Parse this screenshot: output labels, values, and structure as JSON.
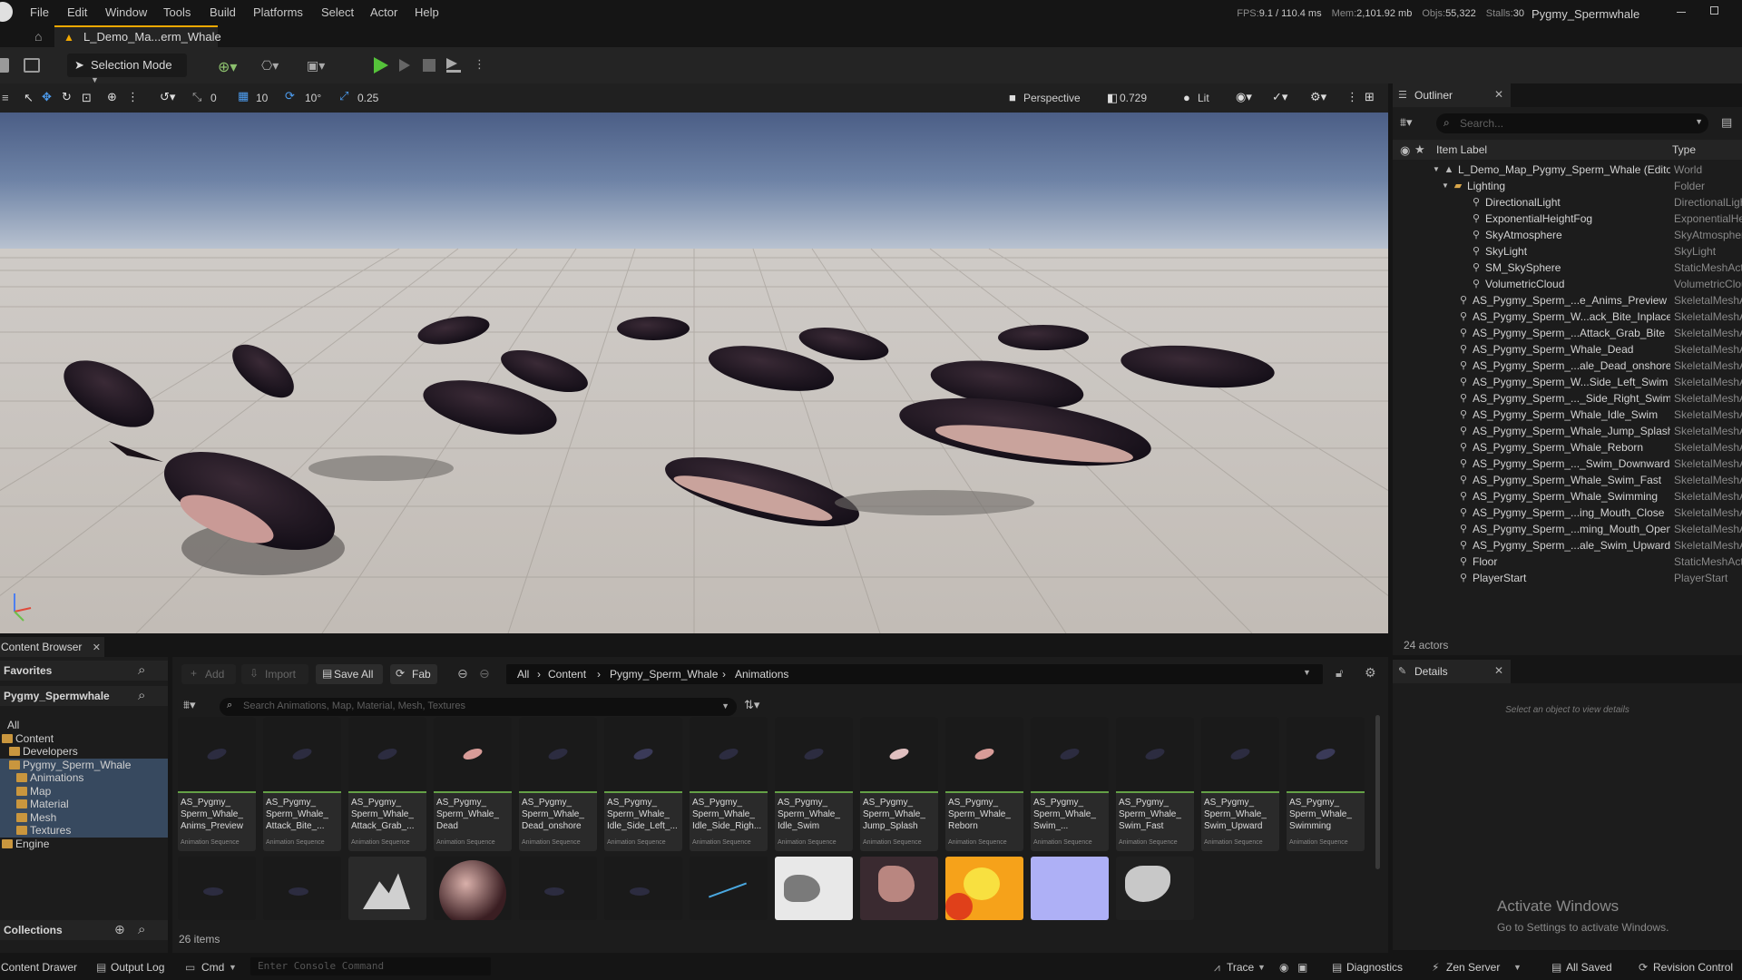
{
  "menu": [
    "File",
    "Edit",
    "Window",
    "Tools",
    "Build",
    "Platforms",
    "Select",
    "Actor",
    "Help"
  ],
  "stats": {
    "fps_label": "FPS:",
    "fps": "9.1",
    "ms": "/ 110.4 ms",
    "mem_label": "Mem:",
    "mem": "2,101.92 mb",
    "objs_label": "Objs:",
    "objs": "55,322",
    "stalls_label": "Stalls:",
    "stalls": "30"
  },
  "project_name": "Pygmy_Spermwhale",
  "level_tab": "L_Demo_Ma...erm_Whale",
  "toolbar": {
    "selection_mode": "Selection Mode"
  },
  "viewport": {
    "snap_rotate": "0",
    "grid_snap": "10",
    "rotation_snap": "10°",
    "scale_snap": "0.25",
    "perspective": "Perspective",
    "fov": "0.729",
    "view_mode": "Lit"
  },
  "outliner": {
    "tab": "Outliner",
    "search_placeholder": "Search...",
    "col_label": "Item Label",
    "col_type": "Type",
    "items": [
      {
        "label": "L_Demo_Map_Pygmy_Sperm_Whale (Editor)",
        "type": "World",
        "indent": 0
      },
      {
        "label": "Lighting",
        "type": "Folder",
        "indent": 1
      },
      {
        "label": "DirectionalLight",
        "type": "DirectionalLight",
        "indent": 2
      },
      {
        "label": "ExponentialHeightFog",
        "type": "ExponentialHeightFog",
        "indent": 2
      },
      {
        "label": "SkyAtmosphere",
        "type": "SkyAtmosphere",
        "indent": 2
      },
      {
        "label": "SkyLight",
        "type": "SkyLight",
        "indent": 2
      },
      {
        "label": "SM_SkySphere",
        "type": "StaticMeshActor",
        "indent": 2
      },
      {
        "label": "VolumetricCloud",
        "type": "VolumetricCloud",
        "indent": 2
      },
      {
        "label": "AS_Pygmy_Sperm_...e_Anims_Preview",
        "type": "SkeletalMeshActor",
        "indent": 1
      },
      {
        "label": "AS_Pygmy_Sperm_W...ack_Bite_Inplace",
        "type": "SkeletalMeshActor",
        "indent": 1
      },
      {
        "label": "AS_Pygmy_Sperm_...Attack_Grab_Bite",
        "type": "SkeletalMeshActor",
        "indent": 1
      },
      {
        "label": "AS_Pygmy_Sperm_Whale_Dead",
        "type": "SkeletalMeshActor",
        "indent": 1
      },
      {
        "label": "AS_Pygmy_Sperm_...ale_Dead_onshore",
        "type": "SkeletalMeshActor",
        "indent": 1
      },
      {
        "label": "AS_Pygmy_Sperm_W...Side_Left_Swim",
        "type": "SkeletalMeshActor",
        "indent": 1
      },
      {
        "label": "AS_Pygmy_Sperm_..._Side_Right_Swim",
        "type": "SkeletalMeshActor",
        "indent": 1
      },
      {
        "label": "AS_Pygmy_Sperm_Whale_Idle_Swim",
        "type": "SkeletalMeshActor",
        "indent": 1
      },
      {
        "label": "AS_Pygmy_Sperm_Whale_Jump_Splash",
        "type": "SkeletalMeshActor",
        "indent": 1
      },
      {
        "label": "AS_Pygmy_Sperm_Whale_Reborn",
        "type": "SkeletalMeshActor",
        "indent": 1
      },
      {
        "label": "AS_Pygmy_Sperm_..._Swim_Downward",
        "type": "SkeletalMeshActor",
        "indent": 1
      },
      {
        "label": "AS_Pygmy_Sperm_Whale_Swim_Fast",
        "type": "SkeletalMeshActor",
        "indent": 1
      },
      {
        "label": "AS_Pygmy_Sperm_Whale_Swimming",
        "type": "SkeletalMeshActor",
        "indent": 1
      },
      {
        "label": "AS_Pygmy_Sperm_...ing_Mouth_Close",
        "type": "SkeletalMeshActor",
        "indent": 1
      },
      {
        "label": "AS_Pygmy_Sperm_...ming_Mouth_Open",
        "type": "SkeletalMeshActor",
        "indent": 1
      },
      {
        "label": "AS_Pygmy_Sperm_...ale_Swim_Upward",
        "type": "SkeletalMeshActor",
        "indent": 1
      },
      {
        "label": "Floor",
        "type": "StaticMeshActor",
        "indent": 1
      },
      {
        "label": "PlayerStart",
        "type": "PlayerStart",
        "indent": 1
      }
    ],
    "actor_count": "24 actors"
  },
  "details": {
    "tab": "Details",
    "empty_message": "Select an object to view details"
  },
  "activate_windows": {
    "title": "Activate Windows",
    "subtitle": "Go to Settings to activate Windows."
  },
  "content_browser": {
    "tab": "Content Browser",
    "favorites": "Favorites",
    "project": "Pygmy_Spermwhale",
    "tree": [
      {
        "label": "All",
        "indent": 0,
        "selected": false
      },
      {
        "label": "Content",
        "indent": 1,
        "selected": false
      },
      {
        "label": "Developers",
        "indent": 2,
        "selected": false
      },
      {
        "label": "Pygmy_Sperm_Whale",
        "indent": 2,
        "selected": true
      },
      {
        "label": "Animations",
        "indent": 3,
        "selected": true
      },
      {
        "label": "Map",
        "indent": 3,
        "selected": true
      },
      {
        "label": "Material",
        "indent": 3,
        "selected": true
      },
      {
        "label": "Mesh",
        "indent": 3,
        "selected": true
      },
      {
        "label": "Textures",
        "indent": 3,
        "selected": true
      },
      {
        "label": "Engine",
        "indent": 1,
        "selected": false
      }
    ],
    "collections": "Collections",
    "add": "Add",
    "import": "Import",
    "save_all": "Save All",
    "fab": "Fab",
    "breadcrumb": [
      "All",
      "Content",
      "Pygmy_Sperm_Whale",
      "Animations"
    ],
    "search_placeholder": "Search Animations, Map, Material, Mesh, Textures",
    "assets": [
      {
        "name": "AS_Pygmy_ Sperm_Whale_ Anims_Preview",
        "type": "Animation Sequence"
      },
      {
        "name": "AS_Pygmy_ Sperm_Whale_ Attack_Bite_...",
        "type": "Animation Sequence"
      },
      {
        "name": "AS_Pygmy_ Sperm_Whale_ Attack_Grab_...",
        "type": "Animation Sequence"
      },
      {
        "name": "AS_Pygmy_ Sperm_Whale_ Dead",
        "type": "Animation Sequence"
      },
      {
        "name": "AS_Pygmy_ Sperm_Whale_ Dead_onshore",
        "type": "Animation Sequence"
      },
      {
        "name": "AS_Pygmy_ Sperm_Whale_ Idle_Side_Left_...",
        "type": "Animation Sequence"
      },
      {
        "name": "AS_Pygmy_ Sperm_Whale_ Idle_Side_Righ...",
        "type": "Animation Sequence"
      },
      {
        "name": "AS_Pygmy_ Sperm_Whale_ Idle_Swim",
        "type": "Animation Sequence"
      },
      {
        "name": "AS_Pygmy_ Sperm_Whale_ Jump_Splash",
        "type": "Animation Sequence"
      },
      {
        "name": "AS_Pygmy_ Sperm_Whale_ Reborn",
        "type": "Animation Sequence"
      },
      {
        "name": "AS_Pygmy_ Sperm_Whale_ Swim_...",
        "type": "Animation Sequence"
      },
      {
        "name": "AS_Pygmy_ Sperm_Whale_ Swim_Fast",
        "type": "Animation Sequence"
      },
      {
        "name": "AS_Pygmy_ Sperm_Whale_ Swim_Upward",
        "type": "Animation Sequence"
      },
      {
        "name": "AS_Pygmy_ Sperm_Whale_ Swimming",
        "type": "Animation Sequence"
      }
    ],
    "item_count": "26 items"
  },
  "statusbar": {
    "content_drawer": "Content Drawer",
    "output_log": "Output Log",
    "cmd": "Cmd",
    "console_placeholder": "Enter Console Command",
    "trace": "Trace",
    "diagnostics": "Diagnostics",
    "zen_server": "Zen Server",
    "all_saved": "All Saved",
    "revision_control": "Revision Control"
  }
}
